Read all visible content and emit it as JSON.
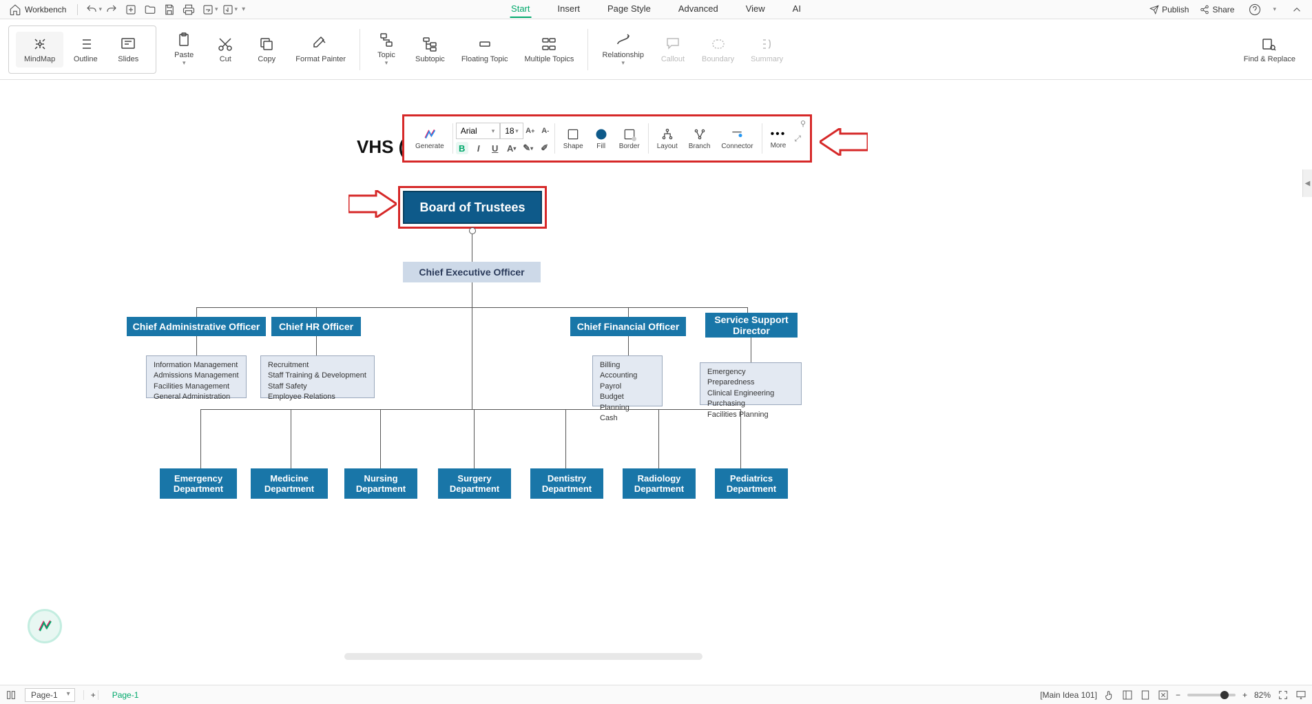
{
  "titlebar": {
    "workbench": "Workbench",
    "menus": [
      "Start",
      "Insert",
      "Page Style",
      "Advanced",
      "View",
      "AI"
    ],
    "activeMenu": 0,
    "publish": "Publish",
    "share": "Share"
  },
  "ribbon": {
    "views": [
      "MindMap",
      "Outline",
      "Slides"
    ],
    "tools": [
      "Paste",
      "Cut",
      "Copy",
      "Format Painter",
      "Topic",
      "Subtopic",
      "Floating Topic",
      "Multiple Topics",
      "Relationship",
      "Callout",
      "Boundary",
      "Summary"
    ],
    "findReplace": "Find & Replace"
  },
  "floatToolbar": {
    "generate": "Generate",
    "font": "Arial",
    "size": "18",
    "shape": "Shape",
    "fill": "Fill",
    "border": "Border",
    "layout": "Layout",
    "branch": "Branch",
    "connector": "Connector",
    "more": "More"
  },
  "chart": {
    "title": "VHS (",
    "root": "Board of Trustees",
    "ceo": "Chief Executive Officer",
    "level2": [
      "Chief Administrative Officer",
      "Chief HR  Officer",
      "Chief Financial Officer",
      "Service Support Director"
    ],
    "adminBox": "Information Management\nAdmissions Management\nFacilities Management\nGeneral Administration",
    "hrBox": "Recruitment\nStaff Training & Development\nStaff Safety\nEmployee Relations",
    "finBox": "Billing\nAccounting\nPayrol\nBudget Planning\nCash",
    "svcBox": "Emergency Preparedness\nClinical Engineering\nPurchasing\nFacilities Planning",
    "depts": [
      "Emergency Department",
      "Medicine Department",
      "Nursing Department",
      "Surgery Department",
      "Dentistry Department",
      "Radiology Department",
      "Pediatrics Department"
    ]
  },
  "statusbar": {
    "pageSelect": "Page-1",
    "tab": "Page-1",
    "mainIdea": "[Main Idea 101]",
    "zoom": "82%"
  }
}
